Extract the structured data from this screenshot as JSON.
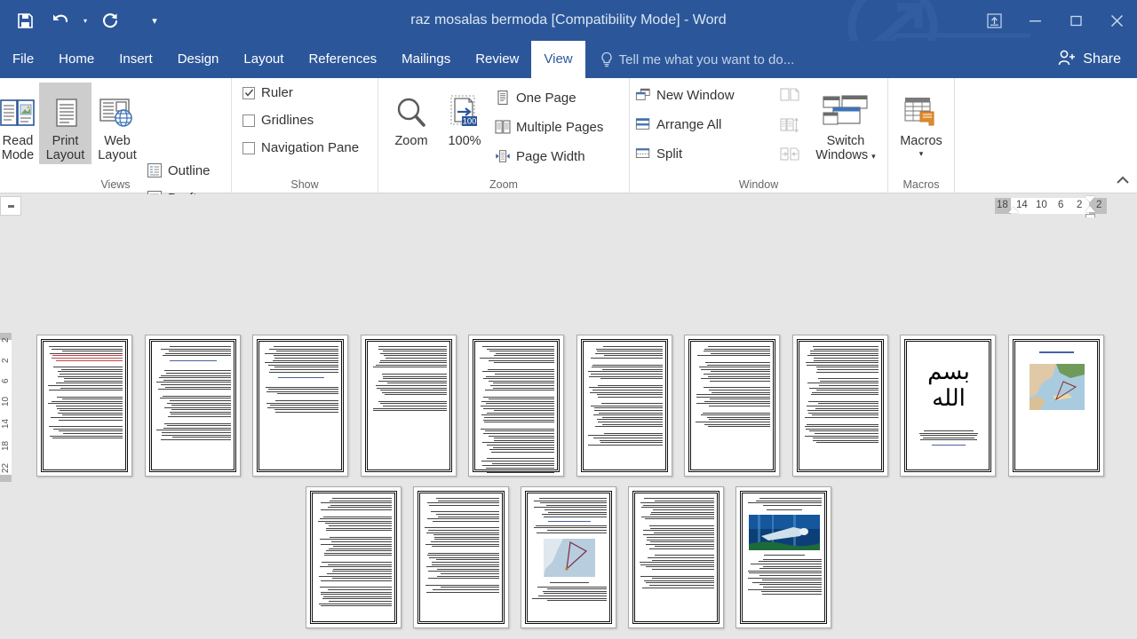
{
  "window": {
    "title": "raz mosalas bermoda [Compatibility Mode] - Word",
    "quick_access": [
      {
        "name": "save",
        "label": "Save"
      },
      {
        "name": "undo",
        "label": "Undo"
      },
      {
        "name": "redo",
        "label": "Repeat"
      },
      {
        "name": "customize",
        "label": "Customize Quick Access Toolbar"
      }
    ],
    "controls": [
      {
        "name": "ribbon-display-options",
        "label": "Ribbon Display Options"
      },
      {
        "name": "minimize",
        "label": "Minimize"
      },
      {
        "name": "restore",
        "label": "Restore Down"
      },
      {
        "name": "close",
        "label": "Close"
      }
    ],
    "accent": "#2b579a",
    "tab_active_text": "#2b579a"
  },
  "tabs": [
    {
      "label": "File",
      "active": false
    },
    {
      "label": "Home",
      "active": false
    },
    {
      "label": "Insert",
      "active": false
    },
    {
      "label": "Design",
      "active": false
    },
    {
      "label": "Layout",
      "active": false
    },
    {
      "label": "References",
      "active": false
    },
    {
      "label": "Mailings",
      "active": false
    },
    {
      "label": "Review",
      "active": false
    },
    {
      "label": "View",
      "active": true
    }
  ],
  "tellme": {
    "placeholder": "Tell me what you want to do..."
  },
  "share": {
    "label": "Share"
  },
  "ribbon": {
    "groups": [
      {
        "name": "views",
        "label": "Views",
        "big_buttons": [
          {
            "label_line1": "Read",
            "label_line2": "Mode",
            "selected": false
          },
          {
            "label_line1": "Print",
            "label_line2": "Layout",
            "selected": true
          },
          {
            "label_line1": "Web",
            "label_line2": "Layout",
            "selected": false
          }
        ],
        "small_buttons": [
          {
            "label": "Outline",
            "disabled": false
          },
          {
            "label": "Draft",
            "disabled": false
          }
        ]
      },
      {
        "name": "show",
        "label": "Show",
        "checkboxes": [
          {
            "label": "Ruler",
            "checked": true
          },
          {
            "label": "Gridlines",
            "checked": false
          },
          {
            "label": "Navigation Pane",
            "checked": false
          }
        ]
      },
      {
        "name": "zoom",
        "label": "Zoom",
        "big_buttons": [
          {
            "label_line1": "Zoom",
            "label_line2": "",
            "selected": false
          },
          {
            "label_line1": "100%",
            "label_line2": "",
            "selected": false
          }
        ],
        "small_buttons": [
          {
            "label": "One Page",
            "disabled": false
          },
          {
            "label": "Multiple Pages",
            "disabled": false
          },
          {
            "label": "Page Width",
            "disabled": false
          }
        ]
      },
      {
        "name": "window",
        "label": "Window",
        "small_buttons": [
          {
            "label": "New Window",
            "disabled": false
          },
          {
            "label": "Arrange All",
            "disabled": false
          },
          {
            "label": "Split",
            "disabled": false
          }
        ],
        "icon_only": [
          {
            "name": "view-side-by-side-icon",
            "label": "View Side by Side",
            "disabled": true
          },
          {
            "name": "synchronous-scrolling-icon",
            "label": "Synchronous Scrolling",
            "disabled": true
          },
          {
            "name": "reset-window-position-icon",
            "label": "Reset Window Position",
            "disabled": true
          }
        ],
        "big_buttons": [
          {
            "label_line1": "Switch",
            "label_line2": "Windows",
            "selected": false,
            "has_caret": true
          }
        ]
      },
      {
        "name": "macros",
        "label": "Macros",
        "big_buttons": [
          {
            "label_line1": "Macros",
            "label_line2": "",
            "selected": false,
            "has_caret": true
          }
        ]
      }
    ],
    "collapse_label": "Collapse the Ribbon",
    "zoom_badge": "100"
  },
  "ruler": {
    "horizontal_numbers": [
      "18",
      "14",
      "10",
      "6",
      "2",
      "2"
    ],
    "vertical_numbers": [
      "2",
      "2",
      "6",
      "10",
      "14",
      "18",
      "22"
    ],
    "tab_stop_label": "Left Tab"
  },
  "document": {
    "view_mode": "Multiple Pages",
    "rows": [
      {
        "pages": [
          {
            "n": 1,
            "kind": "text",
            "has_red": true,
            "has_blue": false,
            "image": null
          },
          {
            "n": 2,
            "kind": "text",
            "has_red": false,
            "has_blue": true,
            "image": null
          },
          {
            "n": 3,
            "kind": "text",
            "has_red": false,
            "has_blue": true,
            "image": null
          },
          {
            "n": 4,
            "kind": "text",
            "has_red": false,
            "has_blue": false,
            "image": null
          },
          {
            "n": 5,
            "kind": "text",
            "has_red": false,
            "has_blue": false,
            "image": null
          },
          {
            "n": 6,
            "kind": "text",
            "has_red": false,
            "has_blue": false,
            "image": null
          },
          {
            "n": 7,
            "kind": "text",
            "has_red": false,
            "has_blue": false,
            "image": null
          },
          {
            "n": 8,
            "kind": "text",
            "has_red": false,
            "has_blue": false,
            "image": null
          },
          {
            "n": 9,
            "kind": "title",
            "has_red": false,
            "has_blue": true,
            "image": "bismillah-calligraphy",
            "title_text": "بسم الله"
          },
          {
            "n": 10,
            "kind": "cover",
            "has_red": false,
            "has_blue": false,
            "image": "bermuda-map",
            "heading": "راز مثلث برمودا"
          }
        ]
      },
      {
        "pages": [
          {
            "n": 11,
            "kind": "text",
            "has_red": false,
            "has_blue": false,
            "image": null
          },
          {
            "n": 12,
            "kind": "text",
            "has_red": false,
            "has_blue": false,
            "image": null
          },
          {
            "n": 13,
            "kind": "text",
            "has_red": false,
            "has_blue": false,
            "image": "bermuda-triangle-chart"
          },
          {
            "n": 14,
            "kind": "text",
            "has_red": false,
            "has_blue": false,
            "image": null
          },
          {
            "n": 15,
            "kind": "text",
            "has_red": false,
            "has_blue": false,
            "image": "underwater-plane-photo"
          }
        ]
      }
    ]
  }
}
